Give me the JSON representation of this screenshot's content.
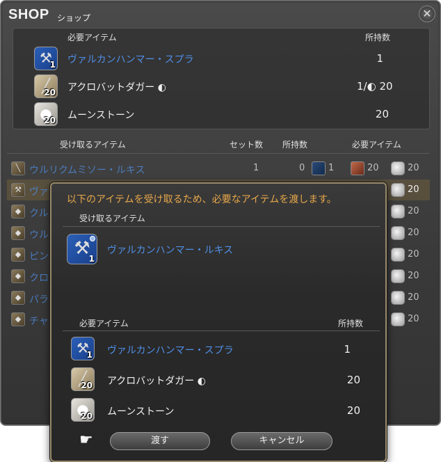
{
  "window": {
    "title": "SHOP",
    "subtitle": "ショップ",
    "close_icon": "gear-close-icon"
  },
  "requirements": {
    "header_item": "必要アイテム",
    "header_owned": "所持数",
    "rows": [
      {
        "name": "ヴァルカンハンマー・スプラ",
        "icon": "hammer-icon",
        "count": "1",
        "owned": "1"
      },
      {
        "name": "アクロバットダガー",
        "icon": "dagger-icon",
        "count": "20",
        "owned": "1/",
        "owned_hq": "20"
      },
      {
        "name": "ムーンストーン",
        "icon": "moonstone-icon",
        "count": "20",
        "owned": "20"
      }
    ]
  },
  "list": {
    "header_receive": "受け取るアイテム",
    "header_sets": "セット数",
    "header_owned": "所持数",
    "header_required": "必要アイテム",
    "rows": [
      {
        "name": "ウルリクムミソー・ルキス",
        "sets": "1",
        "owned": "0",
        "r1": "1",
        "r2": "20",
        "r3": "20"
      },
      {
        "name": "ヴァル",
        "r3": "20"
      },
      {
        "name": "クル",
        "r3": "20"
      },
      {
        "name": "ウル",
        "r3": "20"
      },
      {
        "name": "ピン",
        "r3": "20"
      },
      {
        "name": "クロ",
        "r3": "20"
      },
      {
        "name": "パラ",
        "r3": "20"
      },
      {
        "name": "チャ",
        "r3": "20"
      }
    ]
  },
  "dialog": {
    "message": "以下のアイテムを受け取るため、必要なアイテムを渡します。",
    "receive_header": "受け取るアイテム",
    "receive_item": {
      "name": "ヴァルカンハンマー・ルキス",
      "count": "1"
    },
    "required_header": "必要アイテム",
    "owned_header": "所持数",
    "items": [
      {
        "name": "ヴァルカンハンマー・スプラ",
        "count": "1",
        "owned": "1"
      },
      {
        "name": "アクロバットダガー",
        "count": "20",
        "owned": "20"
      },
      {
        "name": "ムーンストーン",
        "count": "20",
        "owned": "20"
      }
    ],
    "confirm_label": "渡す",
    "cancel_label": "キャンセル"
  }
}
